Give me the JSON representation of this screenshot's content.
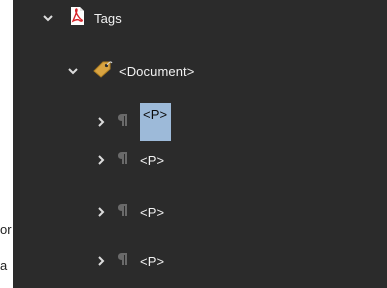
{
  "background_doc": {
    "line1": "or",
    "line2": "a"
  },
  "tree": {
    "root": {
      "label": "Tags",
      "icon": "pdf-icon",
      "expanded": true
    },
    "document": {
      "label": "<Document>",
      "icon": "tag-icon",
      "expanded": true
    },
    "children": [
      {
        "label": "<P>",
        "icon": "paragraph-icon",
        "expanded": false,
        "selected": true
      },
      {
        "label": "<P>",
        "icon": "paragraph-icon",
        "expanded": false,
        "selected": false
      },
      {
        "label": "<P>",
        "icon": "paragraph-icon",
        "expanded": false,
        "selected": false
      },
      {
        "label": "<P>",
        "icon": "paragraph-icon",
        "expanded": false,
        "selected": false
      }
    ]
  },
  "colors": {
    "panel_bg": "#2b2b2b",
    "text": "#f2f2f2",
    "selection": "#9dbad9",
    "pdf_red": "#d8232a",
    "tag_gold": "#d9a441",
    "paragraph_gray": "#6a6a6a"
  }
}
